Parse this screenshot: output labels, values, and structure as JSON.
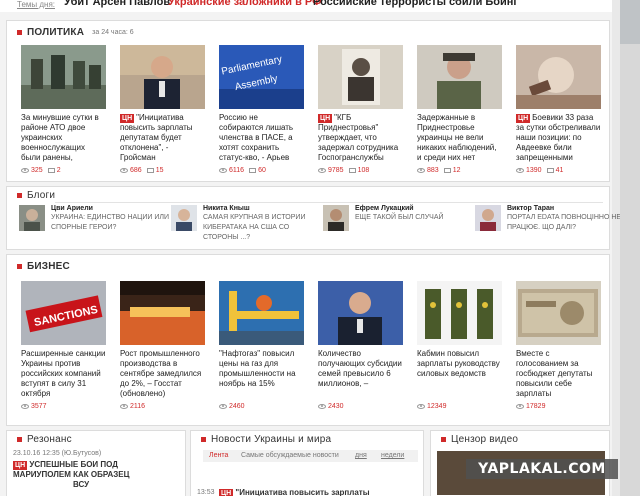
{
  "topbar": {
    "label": "Темы дня:",
    "topics": [
      "Убит Арсен Павлов",
      "Украинские заложники в РФ",
      "Российские террористы сбили Боинг"
    ]
  },
  "politics": {
    "title": "ПОЛИТИКА",
    "subtitle": "за 24 часа: 6",
    "items": [
      {
        "badge": "",
        "title": "За минувшие сутки в районе АТО двое украинских военнослужащих были ранены,",
        "views": "325",
        "comments": "2"
      },
      {
        "badge": "ЦН",
        "title": "\"Инициатива повысить зарплаты депутатам будет отклонена\", - Гройсман",
        "views": "686",
        "comments": "15"
      },
      {
        "badge": "",
        "title": "Россию не собираются лишать членства в ПАСЕ, а хотят сохранить статус-кво, - Арьев",
        "views": "6116",
        "comments": "60"
      },
      {
        "badge": "ЦН",
        "title": "\"КГБ Приднестровья\" утверждает, что задержал сотрудника Госпогранслужбы",
        "views": "9785",
        "comments": "108"
      },
      {
        "badge": "",
        "title": "Задержанные в Приднестровье украинцы не вели никаких наблюдений, и среди них нет",
        "views": "883",
        "comments": "12"
      },
      {
        "badge": "ЦН",
        "title": "Боевики 33 раза за сутки обстреливали наши позиции: по Авдеевке били запрещенными",
        "views": "1390",
        "comments": "41"
      }
    ]
  },
  "blogs": {
    "title": "Блоги",
    "items": [
      {
        "author": "Цви Ариели",
        "text": "УКРАИНА: ЕДИНСТВО НАЦИИ ИЛИ СПОРНЫЕ ГЕРОИ?"
      },
      {
        "author": "Никита Кныш",
        "text": "САМАЯ КРУПНАЯ В ИСТОРИИ КИБЕРАТАКА НА США СО СТОРОНЫ ...?"
      },
      {
        "author": "Ефрем Лукацкий",
        "text": "ЕЩЕ ТАКОЙ БЫЛ СЛУЧАЙ"
      },
      {
        "author": "Виктор Таран",
        "text": "ПОРТАЛ EDATA ПОВНОЦІННО НЕ ПРАЦЮЄ. ЩО ДАЛІ?"
      }
    ]
  },
  "business": {
    "title": "БИЗНЕС",
    "items": [
      {
        "title": "Расширенные санкции Украины против российских компаний вступят в силу 31 октября",
        "views": "3577"
      },
      {
        "title": "Рост промышленного производства в сентябре замедлился до 2%, – Госстат (обновлено)",
        "views": "2116"
      },
      {
        "title": "\"Нафтогаз\" повысил цены на газ для промышленности на ноябрь на 15%",
        "views": "2460"
      },
      {
        "title": "Количество получающих субсидии семей превысило 6 миллионов, –",
        "views": "2430"
      },
      {
        "title": "Кабмин повысил зарплаты руководству силовых ведомств",
        "views": "12349"
      },
      {
        "title": "Вместе с голосованием за госбюджет депутаты повысили себе зарплаты",
        "views": "17829"
      }
    ]
  },
  "resonance": {
    "title": "Резонанс",
    "meta": "23.10.16 12:35 (Ю.Бутусов)",
    "badge": "ЦН",
    "headline_line1": "УСПЕШНЫЕ БОИ ПОД",
    "headline_line2": "МАРИУПОЛЕМ КАК ОБРАЗЕЦ",
    "headline_line3": "ВСУ"
  },
  "news": {
    "title": "Новости Украины и мира",
    "tabs": [
      "Лента",
      "Самые обсуждаемые новости",
      "дня",
      "недели"
    ],
    "first_time": "13:53",
    "first_badge": "ЦН",
    "first_title": "\"Инициатива повысить зарплаты"
  },
  "video": {
    "title": "Цензор видео"
  },
  "watermark": "YAPLAKAL.COM",
  "colors": {
    "accent": "#d02a2a"
  }
}
